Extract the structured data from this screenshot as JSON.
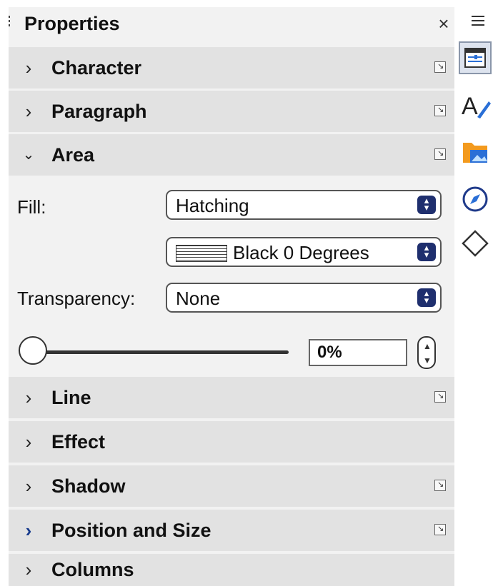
{
  "panel": {
    "title": "Properties",
    "close_glyph": "×"
  },
  "sections": {
    "character": {
      "label": "Character",
      "expanded": false
    },
    "paragraph": {
      "label": "Paragraph",
      "expanded": false
    },
    "area": {
      "label": "Area",
      "expanded": true
    },
    "line": {
      "label": "Line",
      "expanded": false
    },
    "effect": {
      "label": "Effect",
      "expanded": false
    },
    "shadow": {
      "label": "Shadow",
      "expanded": false
    },
    "position_size": {
      "label": "Position and Size",
      "expanded": false
    },
    "columns": {
      "label": "Columns",
      "expanded": false
    }
  },
  "area": {
    "fill_label": "Fill:",
    "fill_value": "Hatching",
    "hatch_value": "Black 0 Degrees",
    "transparency_label": "Transparency:",
    "transparency_value": "None",
    "transparency_percent": "0%",
    "slider_level": 0
  },
  "tabbar": {
    "icons": [
      "hamburger-menu-icon",
      "properties-icon",
      "styles-icon",
      "gallery-icon",
      "navigator-icon",
      "shapes-icon"
    ]
  },
  "colors": {
    "accent": "#1f2f6e",
    "section_bg": "#e2e2e2",
    "panel_bg": "#f2f2f2"
  }
}
